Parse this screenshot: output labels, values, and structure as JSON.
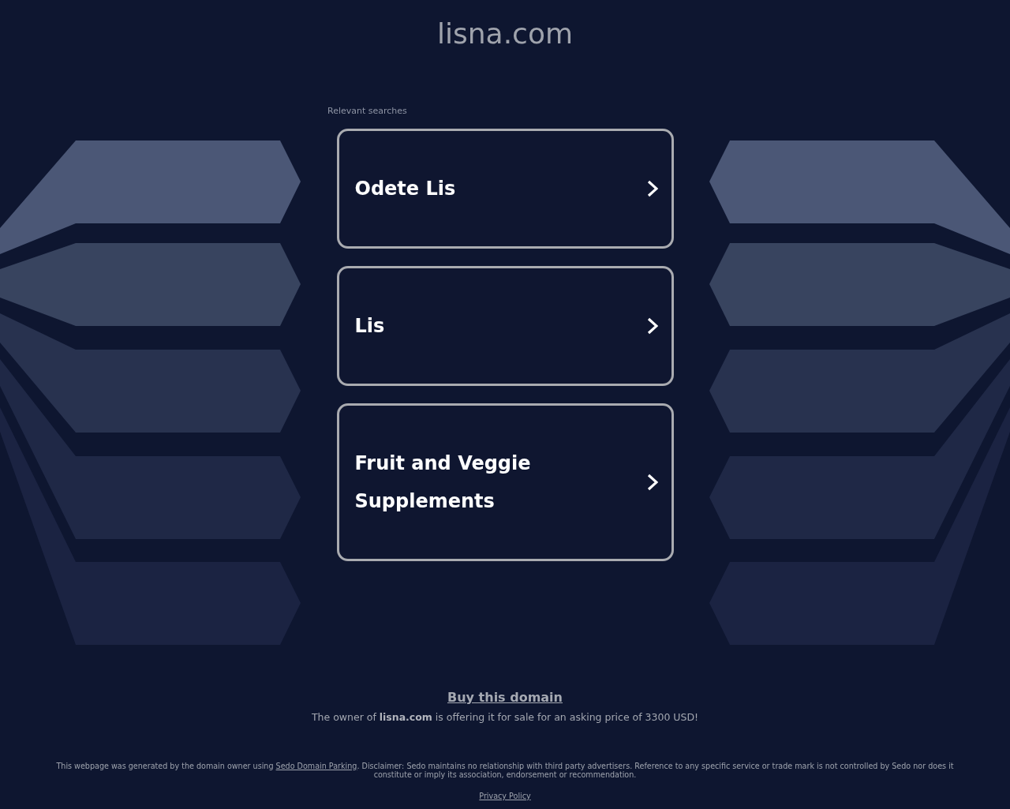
{
  "header": {
    "domain": "lisna.com"
  },
  "searches": {
    "label": "Relevant searches",
    "items": [
      {
        "text": "Odete Lis"
      },
      {
        "text": "Lis"
      },
      {
        "text": "Fruit and Veggie Supplements"
      }
    ]
  },
  "sale": {
    "link": "Buy this domain",
    "message": "The owner of **lisna.com** is offering it for sale for an asking price of 3300 USD!"
  },
  "footer": {
    "disclaimer_start": "This webpage was generated by the domain owner using",
    "disclaimer_link": "Sedo Domain Parking",
    "disclaimer_end": ". Disclaimer: Sedo maintains no relationship with third party advertisers. Reference to any specific service or trade mark is not controlled by Sedo nor does it constitute or imply its association, endorsement or recommendation.",
    "privacy_link": "Privacy Policy"
  }
}
